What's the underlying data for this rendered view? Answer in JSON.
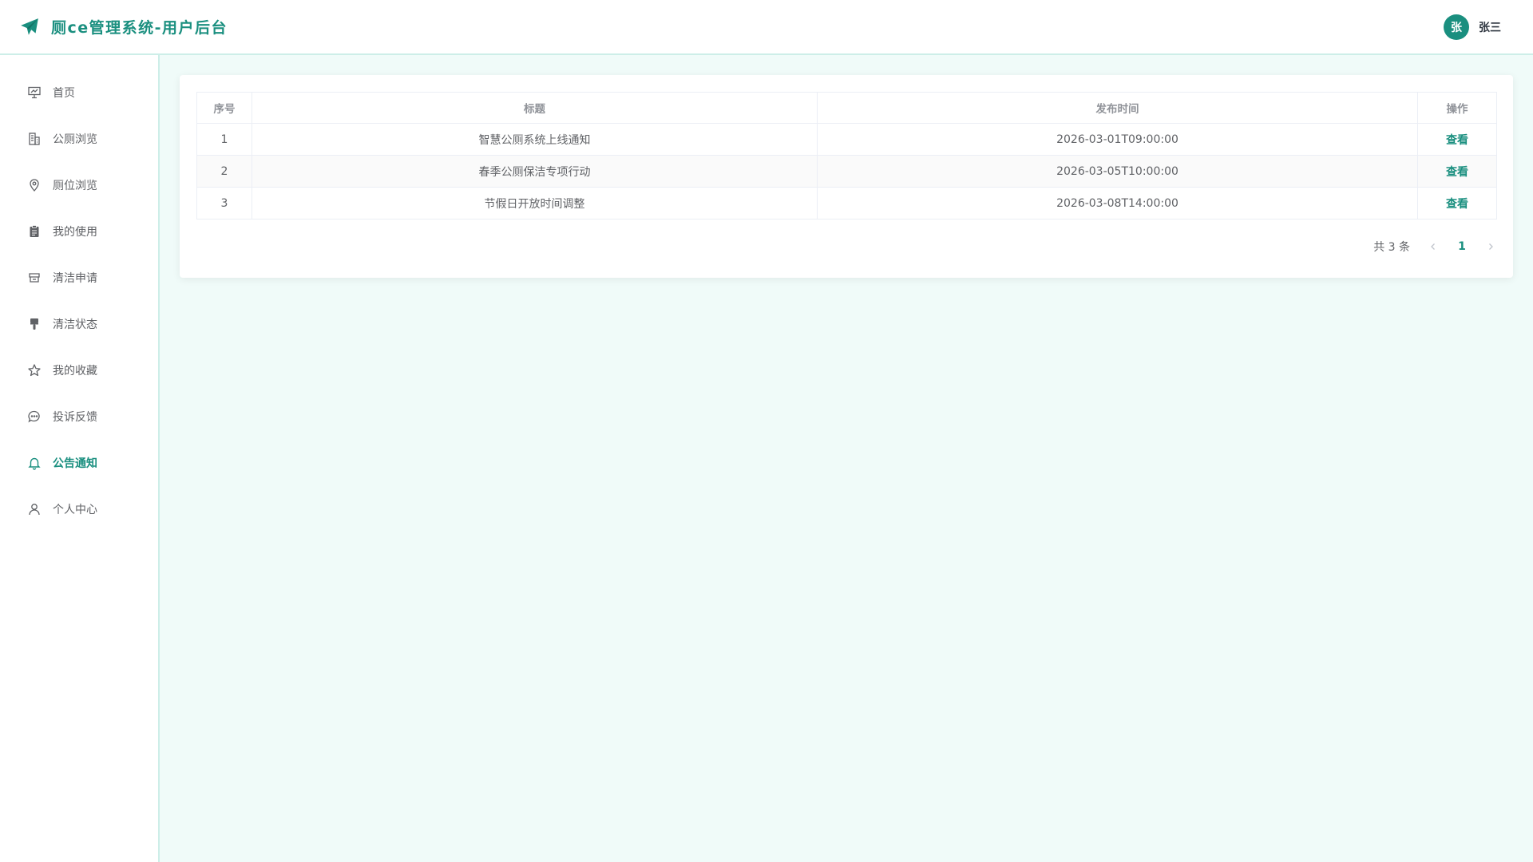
{
  "header": {
    "title": "厕ce管理系统-用户后台",
    "avatar_initial": "张",
    "user_name": "张三"
  },
  "sidebar": {
    "items": [
      {
        "label": "首页",
        "icon": "presentation-board-icon"
      },
      {
        "label": "公厕浏览",
        "icon": "building-icon"
      },
      {
        "label": "厕位浏览",
        "icon": "location-pin-icon"
      },
      {
        "label": "我的使用",
        "icon": "clipboard-icon"
      },
      {
        "label": "清洁申请",
        "icon": "tray-icon"
      },
      {
        "label": "清洁状态",
        "icon": "brush-icon"
      },
      {
        "label": "我的收藏",
        "icon": "star-icon"
      },
      {
        "label": "投诉反馈",
        "icon": "chat-bubble-icon"
      },
      {
        "label": "公告通知",
        "icon": "bell-icon",
        "active": true
      },
      {
        "label": "个人中心",
        "icon": "user-icon"
      }
    ]
  },
  "table": {
    "columns": [
      "序号",
      "标题",
      "发布时间",
      "操作"
    ],
    "rows": [
      {
        "index": "1",
        "title": "智慧公厕系统上线通知",
        "time": "2026-03-01T09:00:00",
        "action": "查看"
      },
      {
        "index": "2",
        "title": "春季公厕保洁专项行动",
        "time": "2026-03-05T10:00:00",
        "action": "查看"
      },
      {
        "index": "3",
        "title": "节假日开放时间调整",
        "time": "2026-03-08T14:00:00",
        "action": "查看"
      }
    ]
  },
  "pagination": {
    "total_text": "共 3 条",
    "current_page": "1"
  },
  "colors": {
    "accent": "#1a8f7f",
    "background": "#f0fbf9",
    "border": "#cdeee8"
  }
}
